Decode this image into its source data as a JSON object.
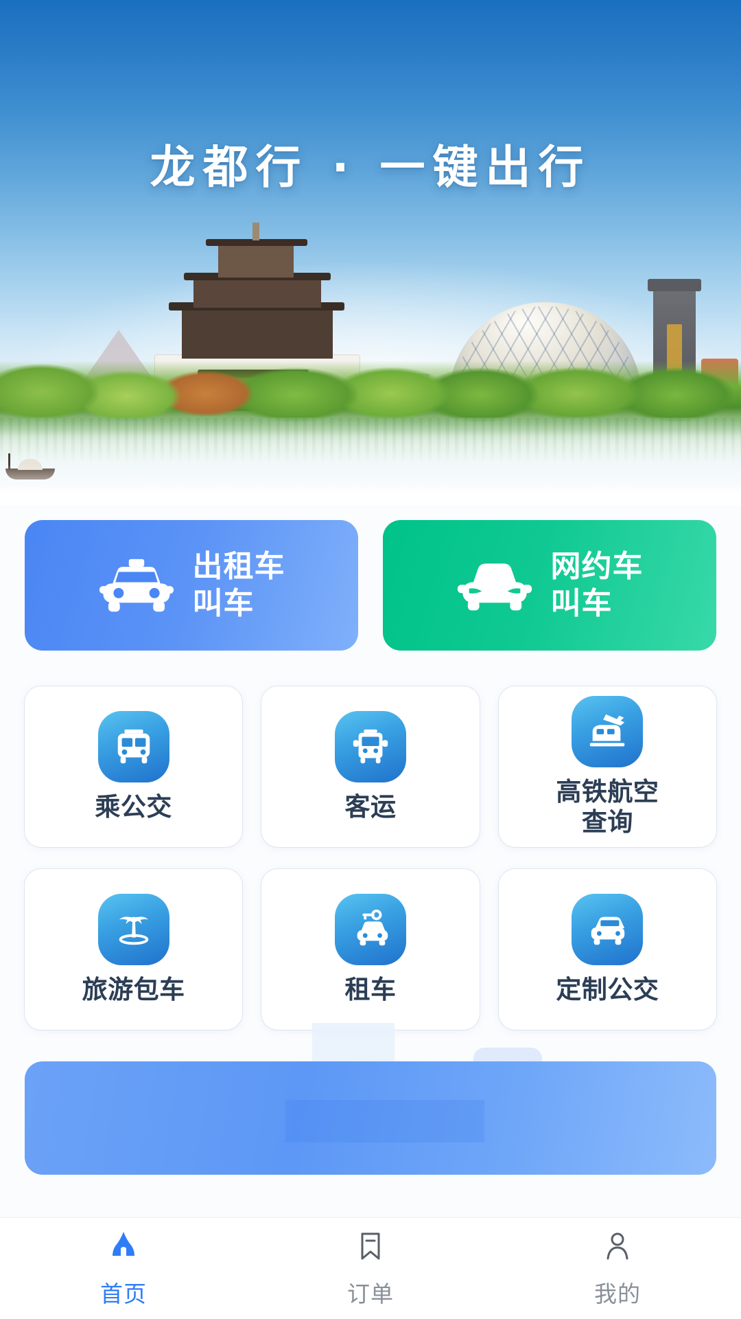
{
  "hero": {
    "title": "龙都行 · 一键出行",
    "scene_name": "city-skyline-illustration",
    "sky_top_color": "#1a6fbf",
    "sky_bottom_color": "#ffffff"
  },
  "primary_actions": [
    {
      "label_line1": "出租车",
      "label_line2": "叫车",
      "icon": "taxi-front-icon",
      "color_from": "#4a86f4",
      "color_to": "#7fb0fa"
    },
    {
      "label_line1": "网约车",
      "label_line2": "叫车",
      "icon": "car-front-icon",
      "color_from": "#00c389",
      "color_to": "#38d9a9"
    }
  ],
  "services": [
    {
      "label": "乘公交",
      "icon": "city-bus-icon"
    },
    {
      "label": "客运",
      "icon": "coach-bus-icon"
    },
    {
      "label": "高铁航空\n查询",
      "label_line1": "高铁航空",
      "label_line2": "查询",
      "icon": "train-plane-icon"
    },
    {
      "label": "旅游包车",
      "icon": "palm-tree-icon"
    },
    {
      "label": "租车",
      "icon": "car-key-icon"
    },
    {
      "label": "定制公交",
      "icon": "custom-bus-icon"
    }
  ],
  "service_icon_gradient": {
    "from": "#59c3f0",
    "to": "#2072cd"
  },
  "banner": {
    "state": "loading-placeholder",
    "color": "#6ba2f7"
  },
  "tabbar": {
    "items": [
      {
        "label": "首页",
        "icon": "home-icon",
        "active": true
      },
      {
        "label": "订单",
        "icon": "bookmark-icon",
        "active": false
      },
      {
        "label": "我的",
        "icon": "person-icon",
        "active": false
      }
    ],
    "active_color": "#2f7df6",
    "inactive_color": "#8a9099"
  }
}
